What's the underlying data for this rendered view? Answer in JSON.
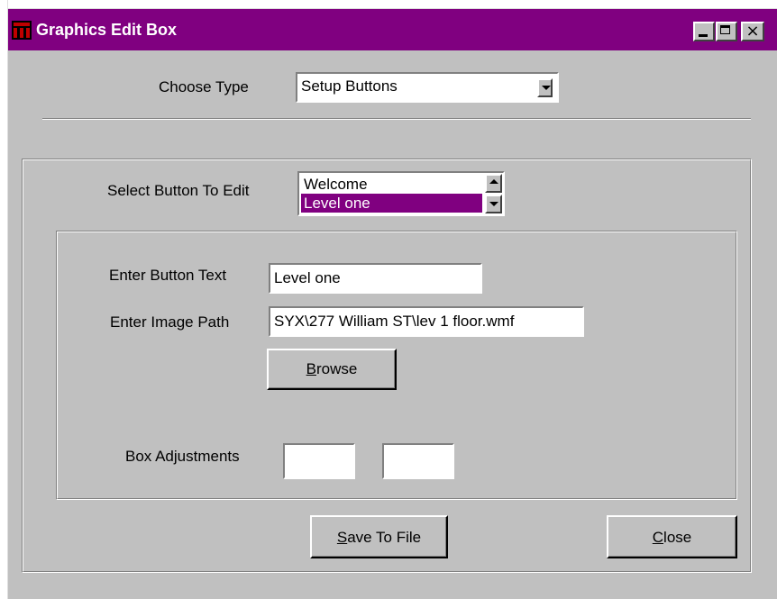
{
  "window": {
    "title": "Graphics Edit Box",
    "buttons": {
      "minimize": "_",
      "maximize": "□",
      "close": "×"
    }
  },
  "choose_type": {
    "label": "Choose Type",
    "selected": "Setup Buttons"
  },
  "select_button": {
    "label": "Select Button To Edit",
    "items": [
      {
        "label": "Welcome",
        "selected": false
      },
      {
        "label": "Level one",
        "selected": true
      }
    ]
  },
  "button_text": {
    "label": "Enter Button Text",
    "value": "Level one"
  },
  "image_path": {
    "label": "Enter Image Path",
    "value": "SYX\\277 William ST\\lev 1 floor.wmf"
  },
  "browse_button": {
    "label_pre": "",
    "label_mnemonic": "B",
    "label_post": "rowse"
  },
  "box_adjustments": {
    "label": "Box Adjustments",
    "value1": "",
    "value2": ""
  },
  "save_button": {
    "label_pre": "",
    "label_mnemonic": "S",
    "label_post": "ave To File"
  },
  "close_button": {
    "label_pre": "",
    "label_mnemonic": "C",
    "label_post": "lose"
  },
  "colors": {
    "titlebar": "#800080",
    "face": "#c0c0c0",
    "selection": "#800080"
  }
}
